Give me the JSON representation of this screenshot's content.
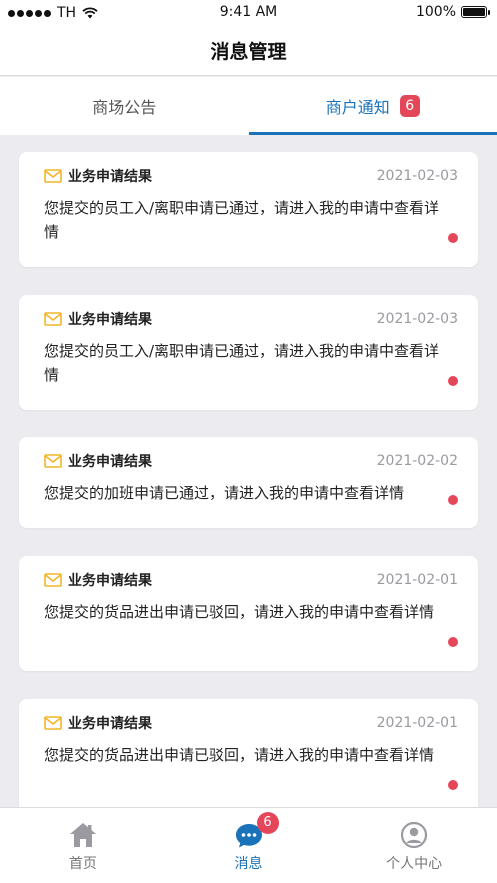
{
  "status_bar": {
    "carrier": "TH",
    "time": "9:41 AM",
    "battery": "100%"
  },
  "page": {
    "title": "消息管理"
  },
  "tabs": [
    {
      "label": "商场公告",
      "active": false
    },
    {
      "label": "商户通知",
      "active": true,
      "badge": "6"
    }
  ],
  "messages": [
    {
      "title": "业务申请结果",
      "date": "2021-02-03",
      "body": "您提交的员工入/离职申请已通过，请进入我的申请中查看详情",
      "unread": true
    },
    {
      "title": "业务申请结果",
      "date": "2021-02-03",
      "body": "您提交的员工入/离职申请已通过，请进入我的申请中查看详情",
      "unread": true
    },
    {
      "title": "业务申请结果",
      "date": "2021-02-02",
      "body": "您提交的加班申请已通过，请进入我的申请中查看详情",
      "unread": true
    },
    {
      "title": "业务申请结果",
      "date": "2021-02-01",
      "body": "您提交的货品进出申请已驳回，请进入我的申请中查看详情",
      "unread": true
    },
    {
      "title": "业务申请结果",
      "date": "2021-02-01",
      "body": "您提交的货品进出申请已驳回，请进入我的申请中查看详情",
      "unread": true
    }
  ],
  "tabbar": [
    {
      "label": "首页",
      "icon": "home-icon",
      "active": false
    },
    {
      "label": "消息",
      "icon": "chat-icon",
      "active": true,
      "badge": "6"
    },
    {
      "label": "个人中心",
      "icon": "user-icon",
      "active": false
    }
  ],
  "colors": {
    "accent": "#1a73b8",
    "badge": "#e5475a",
    "mail_icon": "#f2b52a",
    "background": "#ececf0"
  }
}
